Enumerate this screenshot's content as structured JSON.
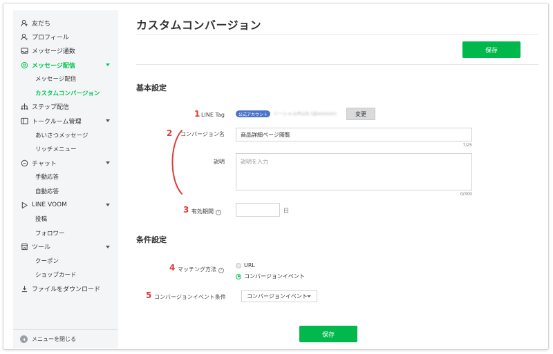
{
  "sidebar": {
    "items": [
      {
        "label": "友だち",
        "icon": "person-icon",
        "level": 0
      },
      {
        "label": "プロフィール",
        "icon": "profile-icon",
        "level": 0
      },
      {
        "label": "メッセージ通数",
        "icon": "inbox-icon",
        "level": 0
      },
      {
        "label": "メッセージ配信",
        "icon": "broadcast-icon",
        "level": 0,
        "active": true,
        "expanded": true
      },
      {
        "label": "メッセージ配信",
        "level": 1
      },
      {
        "label": "カスタムコンバージョン",
        "level": 1,
        "active": true
      },
      {
        "label": "ステップ配信",
        "icon": "step-icon",
        "level": 0
      },
      {
        "label": "トークルーム管理",
        "icon": "talkroom-icon",
        "level": 0,
        "expanded": true
      },
      {
        "label": "あいさつメッセージ",
        "level": 1
      },
      {
        "label": "リッチメニュー",
        "level": 1
      },
      {
        "label": "チャット",
        "icon": "chat-icon",
        "level": 0,
        "expanded": true
      },
      {
        "label": "手動応答",
        "level": 1
      },
      {
        "label": "自動応答",
        "level": 1
      },
      {
        "label": "LINE VOOM",
        "icon": "voom-icon",
        "level": 0,
        "expanded": true
      },
      {
        "label": "投稿",
        "level": 1
      },
      {
        "label": "フォロワー",
        "level": 1
      },
      {
        "label": "ツール",
        "icon": "store-icon",
        "level": 0,
        "expanded": true
      },
      {
        "label": "クーポン",
        "level": 1
      },
      {
        "label": "ショップカード",
        "level": 1
      },
      {
        "label": "ファイルをダウンロード",
        "icon": "download-icon",
        "level": 0
      }
    ],
    "footer_label": "メニューを閉じる"
  },
  "page": {
    "title": "カスタムコンバージョン",
    "save_label": "保存"
  },
  "basic": {
    "section_title": "基本設定",
    "line_tag": {
      "number": "1",
      "label": "LINE Tag",
      "badge": "公式アカウント",
      "account": "ソーシャルPLUS (@xxxxxx)",
      "change_label": "変更"
    },
    "bracket_number": "2",
    "conversion_name": {
      "label": "コンバージョン名",
      "value": "商品詳細ページ閲覧",
      "counter": "7/25"
    },
    "description": {
      "label": "説明",
      "placeholder": "説明を入力",
      "counter": "0/300"
    },
    "validity": {
      "number": "3",
      "label": "有効期間",
      "value": "",
      "unit": "日"
    }
  },
  "conditions": {
    "section_title": "条件設定",
    "matching": {
      "number": "4",
      "label": "マッチング方法",
      "options": [
        {
          "label": "URL",
          "selected": false
        },
        {
          "label": "コンバージョンイベント",
          "selected": true
        }
      ]
    },
    "event_condition": {
      "number": "5",
      "label": "コンバージョンイベント条件",
      "selected": "コンバージョンイベント"
    }
  },
  "colors": {
    "accent_green": "#06c755",
    "button_green": "#00b84c",
    "annotation_red": "#e03a3a",
    "badge_blue": "#4a74c9"
  }
}
